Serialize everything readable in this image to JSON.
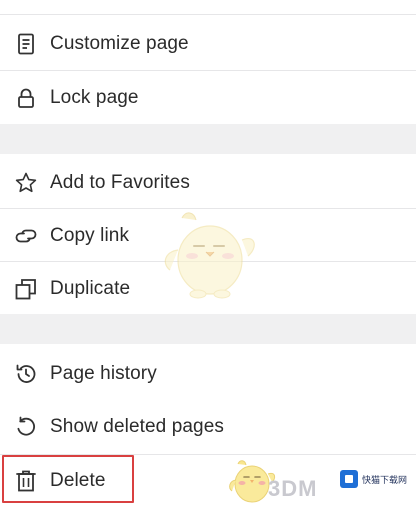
{
  "menu": {
    "group1": [
      {
        "label": "Customize page",
        "icon": "document-icon"
      },
      {
        "label": "Lock page",
        "icon": "lock-icon"
      }
    ],
    "group2": [
      {
        "label": "Add to Favorites",
        "icon": "star-icon"
      },
      {
        "label": "Copy link",
        "icon": "link-icon"
      },
      {
        "label": "Duplicate",
        "icon": "duplicate-icon"
      }
    ],
    "group3": [
      {
        "label": "Page history",
        "icon": "history-icon"
      },
      {
        "label": "Show deleted pages",
        "icon": "restore-icon"
      },
      {
        "label": "Delete",
        "icon": "trash-icon"
      }
    ]
  },
  "watermark": {
    "site_text": "3DM",
    "logo_text": "快猫下载网"
  },
  "colors": {
    "background": "#f0f0f1",
    "row_background": "#ffffff",
    "text": "#2b2b2b",
    "highlight": "#d94040"
  }
}
